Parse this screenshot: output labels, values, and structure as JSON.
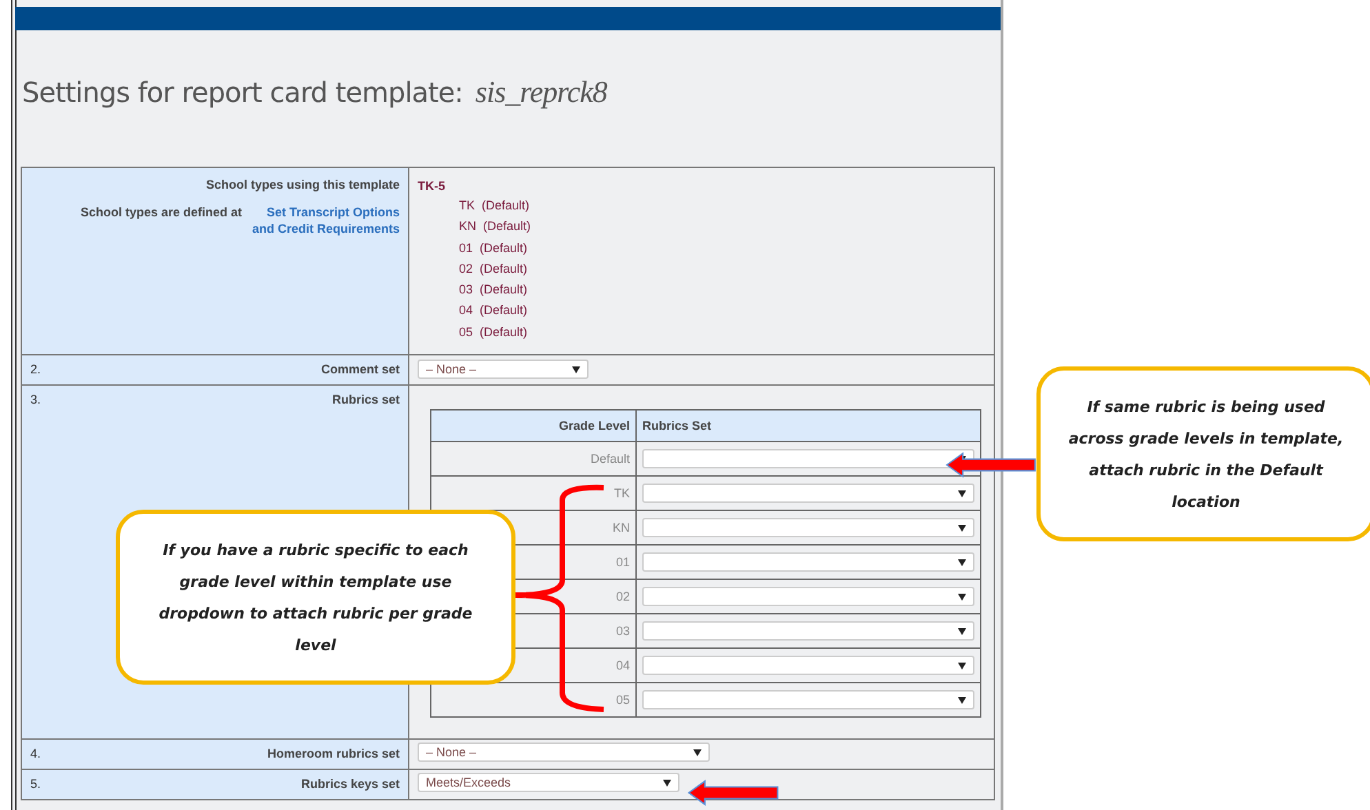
{
  "title": {
    "label": "Settings for report card template:",
    "template": "sis_reprck8"
  },
  "rows": [
    {
      "kind": "school_types",
      "label": "School types using this template",
      "note": "School types are defined at",
      "link": "Set Transcript Options and Credit Requirements",
      "group": "TK-5",
      "grades": [
        {
          "grade": "TK",
          "suffix": "(Default)"
        },
        {
          "grade": "KN",
          "suffix": "(Default)"
        },
        {
          "grade": "01",
          "suffix": "(Default)"
        },
        {
          "grade": "02",
          "suffix": "(Default)"
        },
        {
          "grade": "03",
          "suffix": "(Default)"
        },
        {
          "grade": "04",
          "suffix": "(Default)"
        },
        {
          "grade": "05",
          "suffix": "(Default)"
        }
      ]
    },
    {
      "kind": "select",
      "number": "2.",
      "label": "Comment set",
      "value": "– None –"
    },
    {
      "kind": "rubric_grid",
      "number": "3.",
      "label": "Rubrics set",
      "columns": [
        "Grade Level",
        "Rubrics Set"
      ],
      "grades": [
        "Default",
        "TK",
        "KN",
        "01",
        "02",
        "03",
        "04",
        "05"
      ]
    },
    {
      "kind": "select",
      "number": "4.",
      "label": "Homeroom rubrics set",
      "value": "– None –"
    },
    {
      "kind": "select",
      "number": "5.",
      "label": "Rubrics keys set",
      "value": "Meets/Exceeds"
    }
  ],
  "callouts": [
    {
      "text": "If same rubric is being used across grade levels in template, attach rubric in the Default location"
    },
    {
      "text": "If you have a rubric specific to each grade level within template use dropdown to attach rubric per grade level"
    }
  ]
}
